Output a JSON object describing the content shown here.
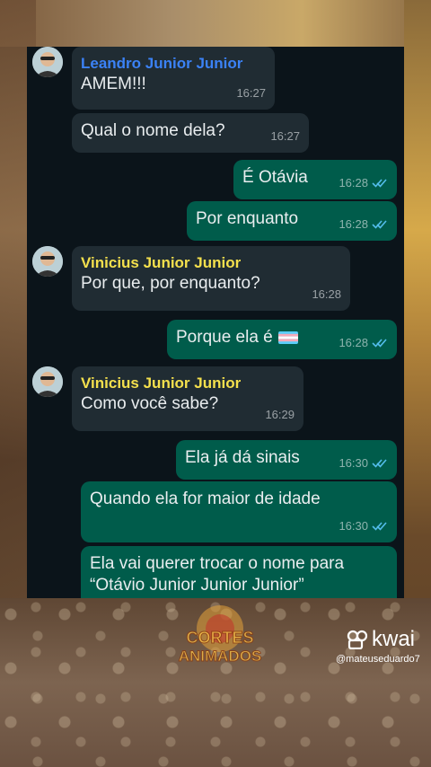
{
  "messages": [
    {
      "id": "m1",
      "sender": "Leandro Junior Junior",
      "sender_color": "#3b82f6",
      "text": "AMEM!!!",
      "time": "16:27"
    },
    {
      "id": "m2",
      "text": "Qual o nome dela?",
      "time": "16:27"
    },
    {
      "id": "m3",
      "text": "É Otávia",
      "time": "16:28"
    },
    {
      "id": "m4",
      "text": "Por enquanto",
      "time": "16:28"
    },
    {
      "id": "m5",
      "sender": "Vinicius Junior Junior",
      "sender_color": "#f4e04d",
      "text": "Por que, por enquanto?",
      "time": "16:28"
    },
    {
      "id": "m6",
      "text": "Porque ela é",
      "time": "16:28"
    },
    {
      "id": "m7",
      "sender": "Vinicius Junior Junior",
      "sender_color": "#f4e04d",
      "text": "Como você sabe?",
      "time": "16:29"
    },
    {
      "id": "m8",
      "text": "Ela já dá sinais",
      "time": "16:30"
    },
    {
      "id": "m9",
      "text": "Quando ela for maior de idade",
      "time": "16:30"
    },
    {
      "id": "m10",
      "text": "Ela vai querer trocar o nome para",
      "text2": "“Otávio Junior Junior Junior”"
    }
  ],
  "watermark": {
    "line1": "CORTES",
    "line2": "ANIMADOS"
  },
  "kwai": {
    "brand": "kwai",
    "handle": "@mateuseduardo7"
  },
  "colors": {
    "outgoing": "#005c4b",
    "incoming": "#202c33",
    "read_tick": "#53bdeb"
  }
}
